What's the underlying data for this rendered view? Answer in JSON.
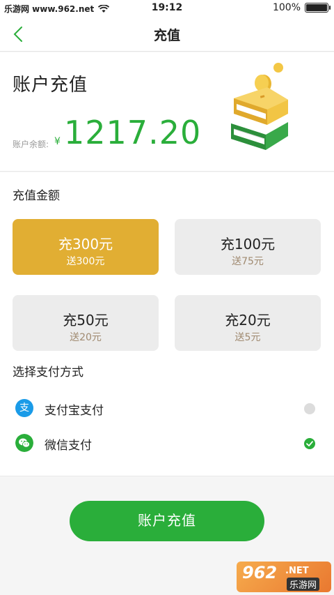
{
  "status_bar": {
    "carrier": "乐游网 www.962.net",
    "time": "19:12",
    "battery_percent": "100%",
    "battery_level": 1.0
  },
  "nav": {
    "title": "充值",
    "back_icon": "chevron-left-icon"
  },
  "header": {
    "title": "账户充值",
    "balance_label": "账户余额:",
    "currency_symbol": "¥",
    "balance": "1217.20",
    "illustration": "books-coins-icon"
  },
  "amount_section": {
    "label": "充值金额",
    "options": [
      {
        "main": "充300元",
        "gift": "送300元",
        "selected": true
      },
      {
        "main": "充100元",
        "gift": "送75元",
        "selected": false
      },
      {
        "main": "充50元",
        "gift": "送20元",
        "selected": false
      },
      {
        "main": "充20元",
        "gift": "送5元",
        "selected": false
      }
    ]
  },
  "payment_section": {
    "label": "选择支付方式",
    "methods": [
      {
        "label": "支付宝支付",
        "icon": "alipay-icon",
        "icon_glyph": "支",
        "selected": false
      },
      {
        "label": "微信支付",
        "icon": "wechat-icon",
        "selected": true
      }
    ]
  },
  "submit_label": "账户充值",
  "watermark": {
    "number": "962",
    "net": ".NET",
    "cn": "乐游网"
  },
  "colors": {
    "accent_green": "#2aae3a",
    "selected_gold": "#e1ae33",
    "alipay_blue": "#1a9be8"
  }
}
